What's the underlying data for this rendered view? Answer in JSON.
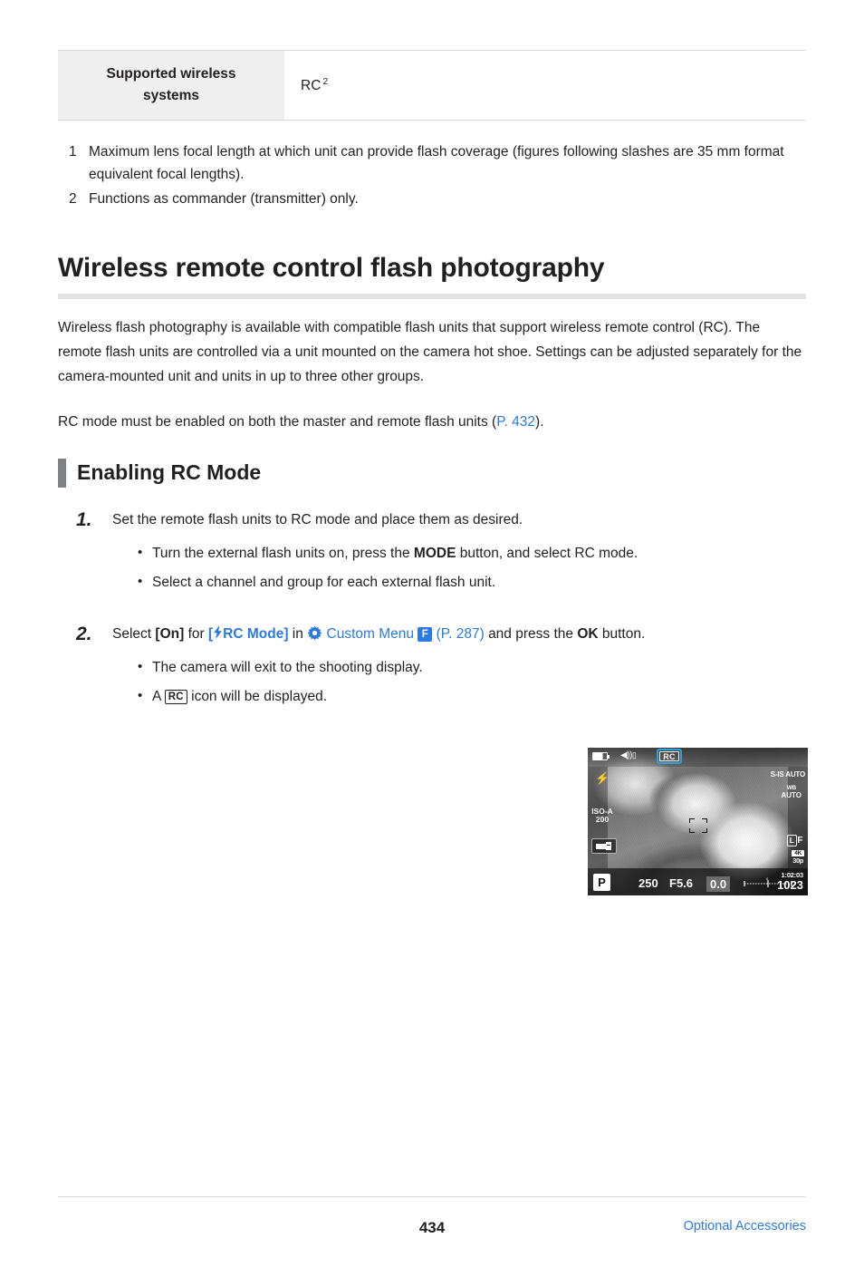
{
  "spec_table": {
    "rows": [
      {
        "label": "Supported wireless systems",
        "value": "RC",
        "value_sup": "2"
      }
    ]
  },
  "footnotes": [
    {
      "num": "1",
      "text": "Maximum lens focal length at which unit can provide flash coverage (figures following slashes are 35 mm format equivalent focal lengths)."
    },
    {
      "num": "2",
      "text": "Functions as commander (transmitter) only."
    }
  ],
  "main_heading": "Wireless remote control flash photography",
  "paragraphs": {
    "intro": "Wireless flash photography is available with compatible flash units that support wireless remote control (RC). The remote flash units are controlled via a unit mounted on the camera hot shoe. Settings can be adjusted separately for the camera-mounted unit and units in up to three other groups.",
    "rc_mode_lead": "RC mode must be enabled on both the master and remote flash units (",
    "rc_mode_link": "P. 432",
    "rc_mode_tail": ")."
  },
  "sub_heading": "Enabling RC Mode",
  "steps": [
    {
      "num": "1.",
      "text": "Set the remote flash units to RC mode and place them as desired.",
      "bullets": [
        {
          "pre": "Turn the external flash units on, press the ",
          "bold": "MODE",
          "post": " button, and select RC mode."
        },
        {
          "pre": "Select a channel and group for each external flash unit.",
          "bold": "",
          "post": ""
        }
      ]
    },
    {
      "num": "2.",
      "select_word": "Select",
      "on_label": "[On]",
      "for_word": "for",
      "rc_bracket_open": "[",
      "rc_mode_label": "RC Mode]",
      "in_word": "in",
      "custom_menu": "Custom Menu",
      "menu_badge": "F",
      "page_ref": "(P. 287)",
      "and_press": "and press the",
      "ok_label": "OK",
      "button_word": "button.",
      "bullets": [
        {
          "pre": "The camera will exit to the shooting display.",
          "bold": "",
          "post": ""
        },
        {
          "pre": "A ",
          "chip": "RC",
          "post": " icon will be displayed."
        }
      ]
    }
  ],
  "camera_display": {
    "rc_indicator": "RC",
    "sound_icon": "sound-icon",
    "battery_icon": "battery-icon",
    "flash_mark": "flash-icon",
    "iso_label": "ISO-A",
    "iso_value": "200",
    "stabilizer": "S-IS AUTO",
    "white_balance": "WB",
    "white_balance_value": "AUTO",
    "quality_box": "L",
    "quality_letter": "F",
    "rec_top": "4K",
    "rec_bottom": "30p",
    "shooting_mode": "P",
    "shutter_speed": "250",
    "aperture": "F5.6",
    "exposure_comp": "0.0",
    "record_time": "1:02:03",
    "shots_remaining": "1023"
  },
  "footer": {
    "page_number": "434",
    "section_link": "Optional Accessories"
  },
  "colors": {
    "link_blue": "#2a7ae2",
    "accent_gray": "#808184",
    "table_header_bg": "#efefef",
    "rule_gray": "#e3e3e5"
  }
}
